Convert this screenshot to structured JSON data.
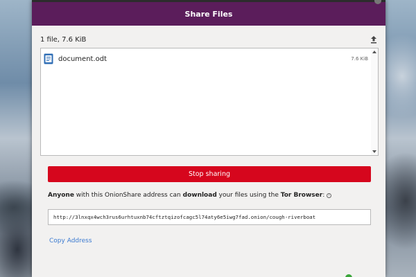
{
  "window": {
    "title": "Share Files"
  },
  "files": {
    "summary": "1 file, 7.6 KiB",
    "items": [
      {
        "name": "document.odt",
        "size": "7.6 KiB"
      }
    ]
  },
  "actions": {
    "stop_label": "Stop sharing",
    "copy_address_label": "Copy Address"
  },
  "share_message": {
    "part1": "Anyone",
    "part2": " with this OnionShare address can ",
    "part3": "download",
    "part4": " your files using the ",
    "part5": "Tor Browser",
    "part6": ":"
  },
  "address": "http://3lnxqx4wch3rus6urhtuxnb74cftztqizofcagc5l74aty6e5iwg7fad.onion/cough-riverboat",
  "colors": {
    "header": "#5b1d5b",
    "stop_button": "#d6061d",
    "link": "#3b7ad0"
  }
}
